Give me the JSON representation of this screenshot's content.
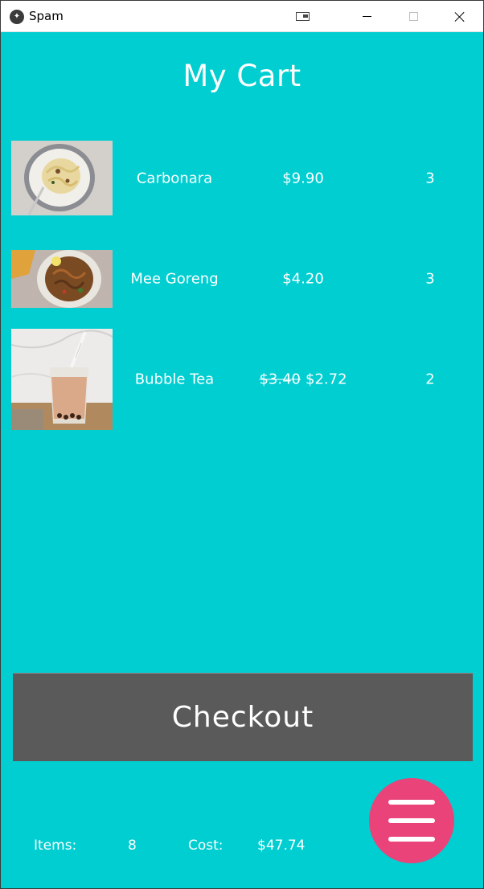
{
  "window": {
    "title": "Spam",
    "app_icon": "kivy-logo-icon"
  },
  "page": {
    "title": "My Cart"
  },
  "cart": {
    "items": [
      {
        "name": "Carbonara",
        "price": "$9.90",
        "original_price": "",
        "quantity": "3",
        "image": "carbonara-image"
      },
      {
        "name": "Mee Goreng",
        "price": "$4.20",
        "original_price": "",
        "quantity": "3",
        "image": "mee-goreng-image"
      },
      {
        "name": "Bubble Tea",
        "price": "$2.72",
        "original_price": "$3.40",
        "quantity": "2",
        "image": "bubble-tea-image"
      }
    ]
  },
  "checkout": {
    "label": "Checkout"
  },
  "summary": {
    "items_label": "Items:",
    "items_value": "8",
    "cost_label": "Cost:",
    "cost_value": "$47.74"
  },
  "menu_button": {
    "icon": "hamburger-menu-icon"
  },
  "colors": {
    "background": "#00CED1",
    "checkout_button": "#5A5A5A",
    "menu_button": "#E9437A",
    "text": "#FFFFFF"
  }
}
